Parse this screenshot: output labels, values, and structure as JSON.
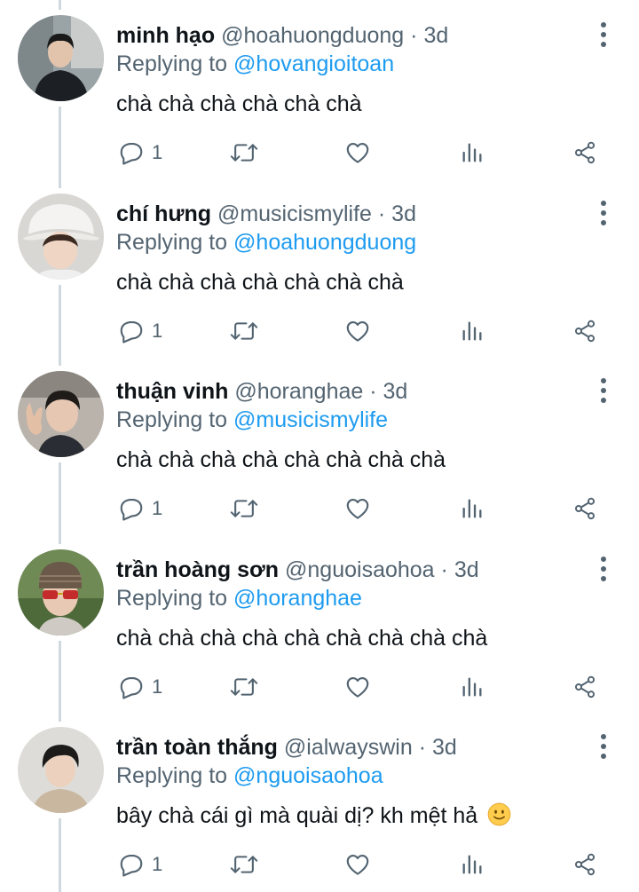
{
  "theme": {
    "name_color": "#0f1419",
    "muted_color": "#536471",
    "mention_color": "#1d9bf0",
    "thread_line_color": "#cfd9de"
  },
  "tweets": [
    {
      "name": "minh hạo",
      "handle": "@hoahuongduong",
      "dot": "·",
      "time": "3d",
      "reply_prefix": "Replying to",
      "reply_to": "@hovangioitoan",
      "text": "chà chà chà chà chà chà",
      "reply_count": "1",
      "emoji": ""
    },
    {
      "name": "chí hưng",
      "handle": "@musicismylife",
      "dot": "·",
      "time": "3d",
      "reply_prefix": "Replying to",
      "reply_to": "@hoahuongduong",
      "text": "chà chà chà chà chà chà chà",
      "reply_count": "1",
      "emoji": ""
    },
    {
      "name": "thuận vinh",
      "handle": "@horanghae",
      "dot": "·",
      "time": "3d",
      "reply_prefix": "Replying to",
      "reply_to": "@musicismylife",
      "text": "chà chà chà chà chà chà chà chà",
      "reply_count": "1",
      "emoji": ""
    },
    {
      "name": "trần hoàng sơn",
      "handle": "@nguoisaohoa",
      "dot": "·",
      "time": "3d",
      "reply_prefix": "Replying to",
      "reply_to": "@horanghae",
      "text": "chà chà chà chà chà chà chà chà chà",
      "reply_count": "1",
      "emoji": ""
    },
    {
      "name": "trần toàn thắng",
      "handle": "@ialwayswin",
      "dot": "·",
      "time": "3d",
      "reply_prefix": "Replying to",
      "reply_to": "@nguoisaohoa",
      "text": "bây chà cái gì mà quài dị? kh mệt hả",
      "reply_count": "1",
      "emoji": "slightly-smiling-face"
    }
  ],
  "icons": {
    "more": "more-vertical-icon",
    "reply": "reply-bubble-icon",
    "retweet": "retweet-icon",
    "like": "heart-icon",
    "analytics": "analytics-bars-icon",
    "share": "share-icon"
  }
}
